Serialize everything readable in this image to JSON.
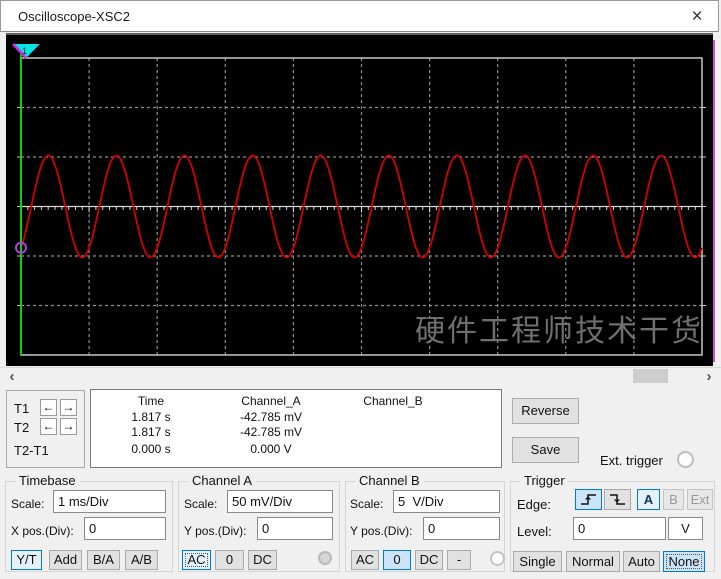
{
  "window": {
    "title": "Oscilloscope-XSC2"
  },
  "icons": {
    "close": "×",
    "arrow_left": "←",
    "arrow_right": "→",
    "scroll_left": "‹",
    "scroll_right": "›"
  },
  "watermark": "硬件工程师技术干货",
  "chart_data": {
    "type": "line",
    "title": "Oscilloscope trace",
    "description": "Single red sine trace (Channel A), ~1 kHz: amplitude ≈ 1 vertical division (≈50 mV at 50 mV/Div), period ≈ 1 horizontal division (1 ms at 1 ms/Div), 10 cycles visible, centered on the 0 V axis",
    "x_divisions": 10,
    "y_divisions": 6,
    "xlabel": "time, 1 ms/Div",
    "ylabel": "Channel A, 50 mV/Div",
    "series": [
      {
        "name": "Channel_A",
        "waveform": "sine",
        "color": "#d40000",
        "amplitude_divs": 1.03,
        "period_divs": 1.0,
        "first_peak_at_div": 0.4,
        "center_offset_divs": 0
      }
    ],
    "cursor": {
      "name": "T1",
      "x_div": 0,
      "line_color": "#00e000",
      "marker_color": "#b040d8",
      "flag_color": "#00e5e5",
      "flag_edge_color": "#e020e0",
      "flag_label": "1"
    },
    "grid": {
      "background": "#000000",
      "line_color": "#8f8f8f",
      "border_color": "#c8c8c8",
      "axis_color": "#d8d8d8"
    }
  },
  "cursors_panel": {
    "rows": [
      {
        "label": "T1"
      },
      {
        "label": "T2"
      },
      {
        "label": "T2-T1"
      }
    ]
  },
  "measurements": {
    "headers": {
      "time": "Time",
      "a": "Channel_A",
      "b": "Channel_B"
    },
    "rows": [
      {
        "time": "1.817 s",
        "a": "-42.785 mV",
        "b": ""
      },
      {
        "time": "1.817 s",
        "a": "-42.785 mV",
        "b": ""
      },
      {
        "time": "0.000 s",
        "a": "0.000 V",
        "b": ""
      }
    ]
  },
  "actions": {
    "reverse": "Reverse",
    "save": "Save",
    "ext_trigger": "Ext. trigger"
  },
  "timebase": {
    "title": "Timebase",
    "scale_label": "Scale:",
    "scale_value": "1 ms/Div",
    "xpos_label": "X pos.(Div):",
    "xpos_value": "0",
    "buttons": [
      {
        "label": "Y/T"
      },
      {
        "label": "Add"
      },
      {
        "label": "B/A"
      },
      {
        "label": "A/B"
      }
    ]
  },
  "channel_a": {
    "title": "Channel A",
    "scale_label": "Scale:",
    "scale_value": "50 mV/Div",
    "ypos_label": "Y pos.(Div):",
    "ypos_value": "0",
    "buttons": [
      {
        "label": "AC"
      },
      {
        "label": "0"
      },
      {
        "label": "DC"
      }
    ]
  },
  "channel_b": {
    "title": "Channel B",
    "scale_label": "Scale:",
    "scale_value": "5  V/Div",
    "ypos_label": "Y pos.(Div):",
    "ypos_value": "0",
    "buttons": [
      {
        "label": "AC"
      },
      {
        "label": "0"
      },
      {
        "label": "DC"
      },
      {
        "label": "-"
      }
    ]
  },
  "trigger": {
    "title": "Trigger",
    "edge_label": "Edge:",
    "source_buttons": [
      {
        "label": "A"
      },
      {
        "label": "B"
      },
      {
        "label": "Ext"
      }
    ],
    "level_label": "Level:",
    "level_value": "0",
    "level_unit": "V",
    "mode_buttons": [
      {
        "label": "Single"
      },
      {
        "label": "Normal"
      },
      {
        "label": "Auto"
      },
      {
        "label": "None"
      }
    ]
  }
}
